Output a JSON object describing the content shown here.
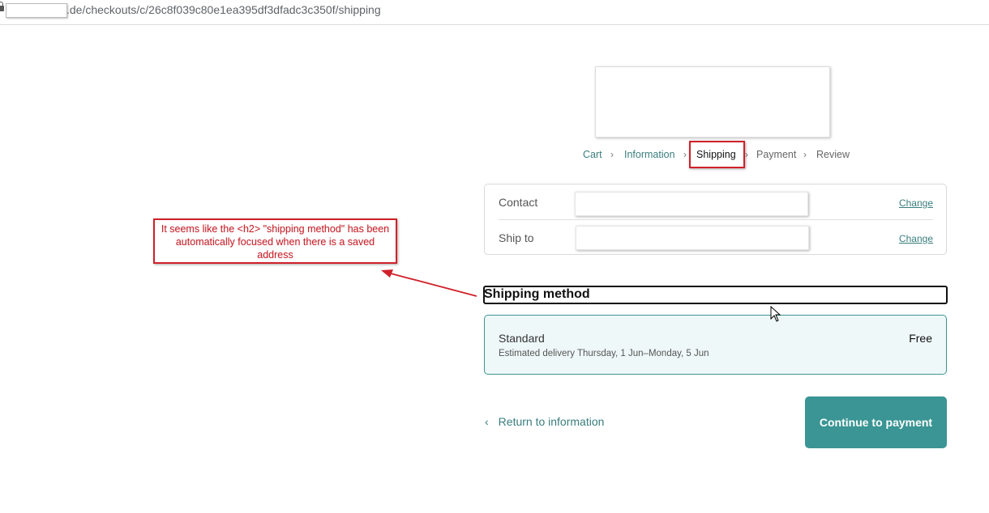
{
  "browser": {
    "url_text": ".de/checkouts/c/26c8f039c80e1ea395df3dfadc3c350f/shipping"
  },
  "breadcrumb": {
    "cart": "Cart",
    "information": "Information",
    "shipping": "Shipping",
    "payment": "Payment",
    "review": "Review",
    "separator": "›"
  },
  "review": {
    "contact_label": "Contact",
    "ship_to_label": "Ship to",
    "change_label": "Change"
  },
  "shipping_method": {
    "heading": "Shipping method",
    "option_name": "Standard",
    "option_eta": "Estimated delivery Thursday, 1 Jun–Monday, 5 Jun",
    "option_price": "Free"
  },
  "footer": {
    "return_chevron": "‹",
    "return_label": "Return to information",
    "continue_label": "Continue to payment"
  },
  "annotation": {
    "text": "It seems like the <h2> \"shipping method\" has been automatically focused when there is a saved address"
  },
  "colors": {
    "accent": "#3a9594",
    "link": "#3a7d7d",
    "annotation_red": "#d0212a",
    "selected_bg": "#eff8f8"
  }
}
